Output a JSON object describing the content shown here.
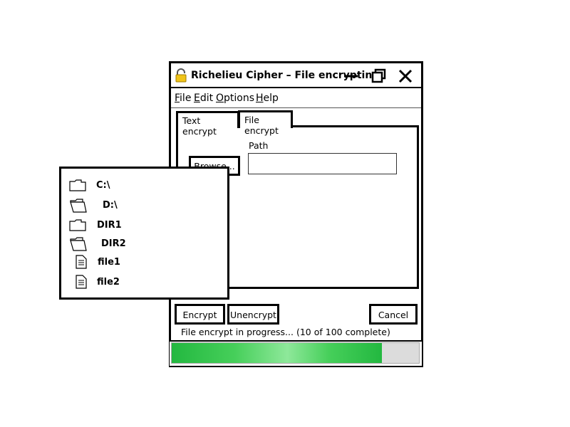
{
  "window": {
    "title": "Richelieu Cipher – File encrypting",
    "icon": "padlock-icon",
    "accent_color": "#f0c419"
  },
  "menu": {
    "items": [
      {
        "accel": "F",
        "rest": "ile"
      },
      {
        "accel": "E",
        "rest": "dit"
      },
      {
        "accel": "O",
        "rest": "ptions"
      },
      {
        "accel": "H",
        "rest": "elp"
      }
    ]
  },
  "tabs": [
    {
      "label": "Text encrypt",
      "active": false
    },
    {
      "label": "File encrypt",
      "active": true
    }
  ],
  "file_tab": {
    "browse_label": "Browse...",
    "path_label": "Path",
    "path_value": ""
  },
  "tree": {
    "items": [
      {
        "label": "C:\\",
        "icon": "folder-icon"
      },
      {
        "label": "D:\\",
        "icon": "folder-open-icon"
      },
      {
        "label": "DIR1",
        "icon": "folder-icon"
      },
      {
        "label": "DIR2",
        "icon": "folder-open-icon"
      },
      {
        "label": "file1",
        "icon": "file-icon"
      },
      {
        "label": "file2",
        "icon": "file-icon"
      }
    ]
  },
  "actions": {
    "encrypt_label": "Encrypt",
    "unencrypt_label": "Unencrypt",
    "cancel_label": "Cancel"
  },
  "status": {
    "text": "File encrypt in progress...",
    "count": "(10 of 100 complete)"
  },
  "progress": {
    "bar_fill_fraction": 0.85,
    "color": "#2fbf45"
  }
}
